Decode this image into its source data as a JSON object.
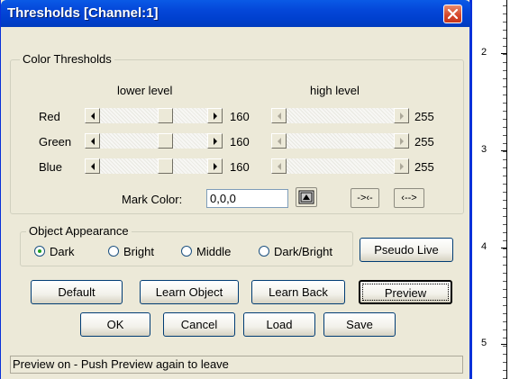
{
  "window": {
    "title": "Thresholds [Channel:1]"
  },
  "color_thresholds": {
    "legend": "Color Thresholds",
    "lower_header": "lower level",
    "high_header": "high level",
    "channels": [
      {
        "name": "Red",
        "lower_value": "160",
        "high_value": "255",
        "lower_level": 160,
        "high_level": 255
      },
      {
        "name": "Green",
        "lower_value": "160",
        "high_value": "255",
        "lower_level": 160,
        "high_level": 255
      },
      {
        "name": "Blue",
        "lower_value": "160",
        "high_value": "255",
        "lower_level": 160,
        "high_level": 255
      }
    ],
    "mark_color_label": "Mark Color:",
    "mark_color_value": "0,0,0",
    "btn_shrink": "->‹-",
    "btn_expand": "‹-->"
  },
  "object_appearance": {
    "legend": "Object Appearance",
    "options": [
      "Dark",
      "Bright",
      "Middle",
      "Dark/Bright"
    ],
    "selected": "Dark",
    "pseudo_live": "Pseudo Live"
  },
  "buttons": {
    "default": "Default",
    "learn_object": "Learn Object",
    "learn_back": "Learn Back",
    "preview": "Preview",
    "ok": "OK",
    "cancel": "Cancel",
    "load": "Load",
    "save": "Save"
  },
  "status": "Preview on - Push Preview again to leave",
  "ruler": {
    "labels": [
      "2",
      "3",
      "4",
      "5"
    ]
  },
  "colors": {
    "titlebar": "#0054e3",
    "window_bg": "#ece9d8",
    "close": "#d5452a",
    "accent_radio": "#21a121"
  }
}
